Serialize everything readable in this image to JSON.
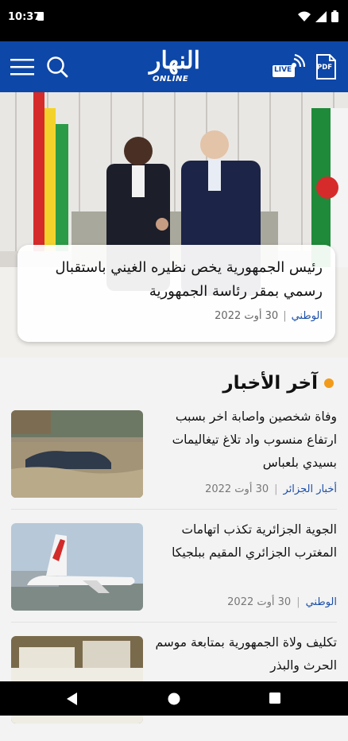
{
  "status_bar": {
    "time": "10:37"
  },
  "header": {
    "logo_ar": "النهار",
    "logo_en": "ONLINE",
    "live_label": "LIVE",
    "pdf_label": "PDF"
  },
  "hero": {
    "title": "رئيس الجمهورية يخص نظيره الغيني باستقبال رسمي بمقر رئاسة الجمهورية",
    "category": "الوطني",
    "date": "30 أوت 2022"
  },
  "section": {
    "title": "آخر الأخبار"
  },
  "news": [
    {
      "title": "وفاة شخصين واصابة اخر بسبب ارتفاع منسوب واد تلاغ تيغاليمات بسيدي بلعباس",
      "category": "أخبار الجزائر",
      "date": "30 أوت 2022"
    },
    {
      "title": "الجوية الجزائرية تكذب اتهامات المغترب الجزائري المقيم ببلجيكا",
      "category": "الوطني",
      "date": "30 أوت 2022"
    },
    {
      "title": "تكليف ولاة الجمهورية بمتابعة موسم الحرث والبذر",
      "category": "",
      "date": ""
    }
  ],
  "colors": {
    "header_bg": "#0d47a8",
    "accent_dot": "#f29b1b",
    "category_text": "#1b4fa8"
  }
}
